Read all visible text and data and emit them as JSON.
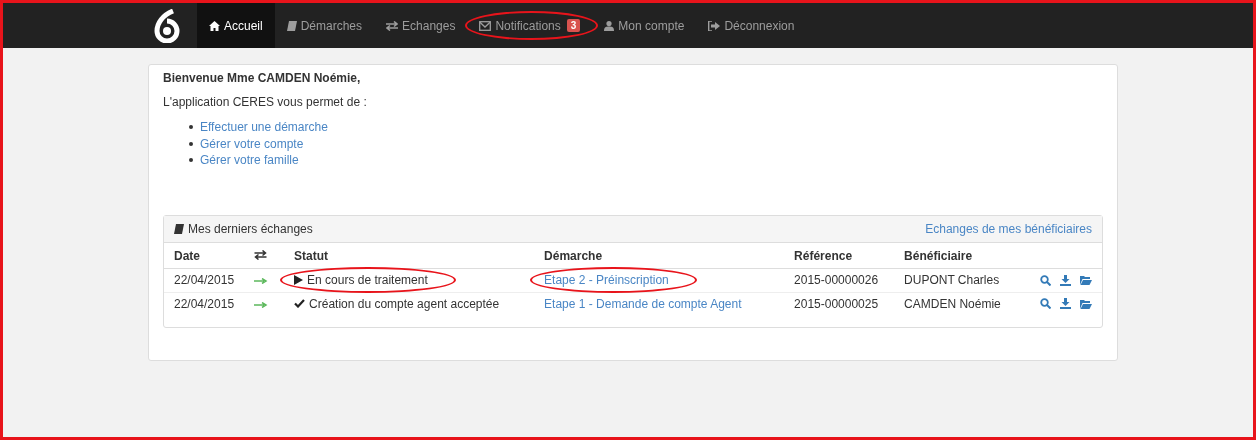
{
  "nav": {
    "items": [
      {
        "kind": "home",
        "label": "Accueil",
        "selected": true,
        "highlighted": false
      },
      {
        "kind": "book",
        "label": "Démarches",
        "selected": false,
        "highlighted": false
      },
      {
        "kind": "swap",
        "label": "Echanges",
        "selected": false,
        "highlighted": false
      },
      {
        "kind": "envelope",
        "label": "Notifications",
        "badge": "3",
        "selected": false,
        "highlighted": true
      },
      {
        "kind": "user",
        "label": "Mon compte",
        "selected": false,
        "highlighted": false
      },
      {
        "kind": "signout",
        "label": "Déconnexion",
        "selected": false,
        "highlighted": false
      }
    ]
  },
  "welcome": {
    "title": "Bienvenue Mme CAMDEN Noémie,",
    "intro": "L'application CERES vous permet de :",
    "links": [
      "Effectuer une démarche",
      "Gérer votre compte",
      "Gérer votre famille"
    ]
  },
  "exchanges": {
    "title": "Mes derniers échanges",
    "link": "Echanges de mes bénéficiaires",
    "columns": [
      {
        "kind": "text",
        "label": "Date"
      },
      {
        "kind": "swap"
      },
      {
        "kind": "text",
        "label": "Statut"
      },
      {
        "kind": "text",
        "label": "Démarche"
      },
      {
        "kind": "text",
        "label": "Référence"
      },
      {
        "kind": "text",
        "label": "Bénéficiaire"
      },
      {
        "kind": "blank"
      }
    ],
    "rows": [
      {
        "date": "22/04/2015",
        "status": {
          "kind": "play",
          "text": "En cours de traitement",
          "highlighted": true
        },
        "demarche": {
          "text": "Etape 2 - Préinscription",
          "highlighted": true
        },
        "reference": "2015-00000026",
        "beneficiaire": "DUPONT Charles"
      },
      {
        "date": "22/04/2015",
        "status": {
          "kind": "check",
          "text": "Création du compte agent acceptée",
          "highlighted": false
        },
        "demarche": {
          "text": "Etape 1 - Demande de compte Agent",
          "highlighted": false
        },
        "reference": "2015-00000025",
        "beneficiaire": "CAMDEN Noémie"
      }
    ]
  }
}
